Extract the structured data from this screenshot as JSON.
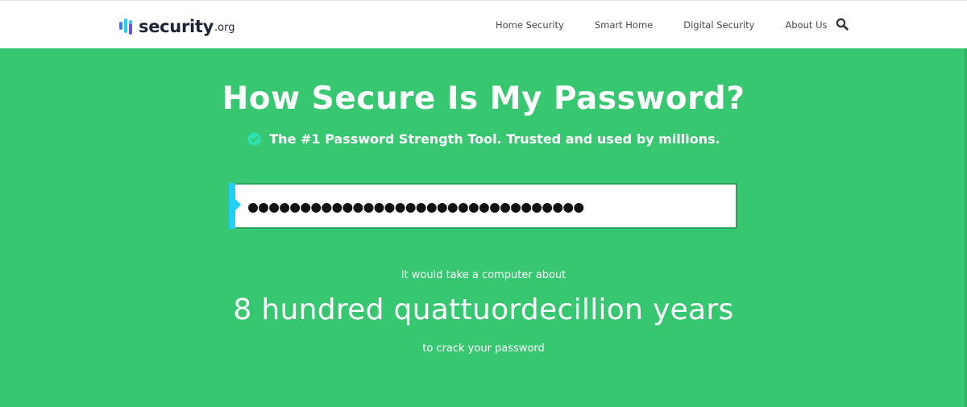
{
  "header": {
    "logo": {
      "word": "security",
      "tld": ".org"
    },
    "nav": [
      {
        "label": "Home Security"
      },
      {
        "label": "Smart Home"
      },
      {
        "label": "Digital Security"
      },
      {
        "label": "About Us"
      }
    ],
    "search_icon": "search-icon"
  },
  "hero": {
    "title": "How Secure Is My Password?",
    "tagline": "The #1 Password Strength Tool. Trusted and used by millions.",
    "password_value": "●●●●●●●●●●●●●●●●●●●●●●●●●●●●●●●●",
    "result": {
      "pre": "It would take a computer about",
      "time": "8 hundred quattuordecillion years",
      "post": "to crack your password"
    }
  },
  "colors": {
    "hero_bg": "#36c770",
    "accent": "#22d0f5",
    "check_badge": "#2fe0b0",
    "text_dark": "#1e2235"
  }
}
